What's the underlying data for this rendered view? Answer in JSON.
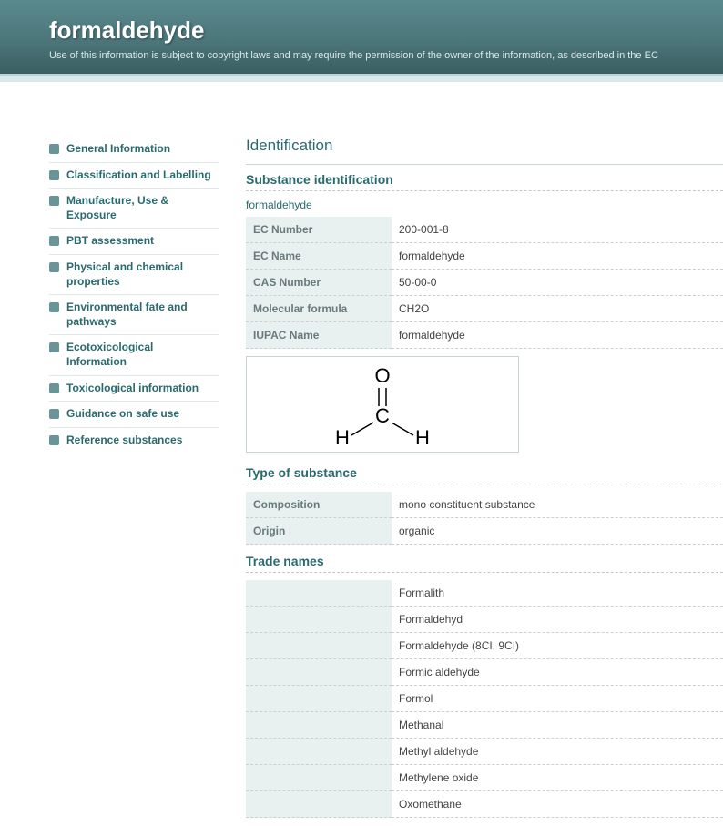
{
  "header": {
    "title": "formaldehyde",
    "subtitle": "Use of this information is subject to copyright laws and may require the permission of the owner of the information, as described in the EC"
  },
  "sidebar": {
    "items": [
      {
        "label": "General Information"
      },
      {
        "label": "Classification and Labelling"
      },
      {
        "label": "Manufacture, Use & Exposure"
      },
      {
        "label": "PBT assessment"
      },
      {
        "label": "Physical and chemical properties"
      },
      {
        "label": "Environmental fate and pathways"
      },
      {
        "label": "Ecotoxicological Information"
      },
      {
        "label": "Toxicological information"
      },
      {
        "label": "Guidance on safe use"
      },
      {
        "label": "Reference substances"
      }
    ]
  },
  "main": {
    "page_heading": "Identification",
    "section1_title": "Substance identification",
    "substance_name": "formaldehyde",
    "identification_rows": [
      {
        "label": "EC Number",
        "value": "200-001-8"
      },
      {
        "label": "EC Name",
        "value": "formaldehyde"
      },
      {
        "label": "CAS Number",
        "value": "50-00-0"
      },
      {
        "label": "Molecular formula",
        "value": "CH2O"
      },
      {
        "label": "IUPAC Name",
        "value": "formaldehyde"
      }
    ],
    "section2_title": "Type of substance",
    "type_rows": [
      {
        "label": "Composition",
        "value": "mono constituent substance"
      },
      {
        "label": "Origin",
        "value": "organic"
      }
    ],
    "section3_title": "Trade names",
    "trade_names": [
      "Formalith",
      "Formaldehyd",
      "Formaldehyde (8CI, 9CI)",
      "Formic aldehyde",
      "Formol",
      "Methanal",
      "Methyl aldehyde",
      "Methylene oxide",
      "Oxomethane"
    ]
  }
}
